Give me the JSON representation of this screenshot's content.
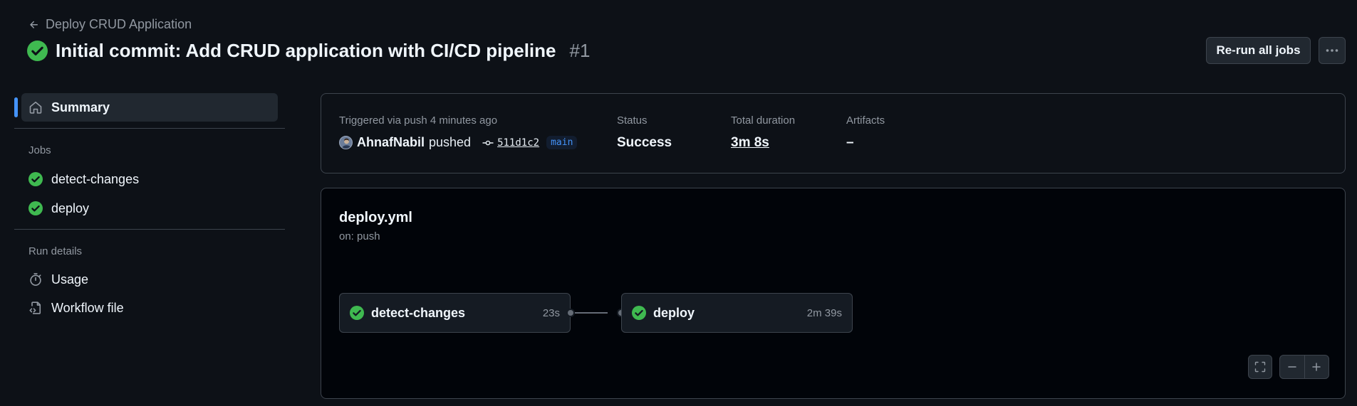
{
  "header": {
    "back_label": "Deploy CRUD Application",
    "title": "Initial commit: Add CRUD application with CI/CD pipeline",
    "run_number": "#1",
    "rerun_label": "Re-run all jobs",
    "status_icon": "check-circle-fill-icon"
  },
  "sidebar": {
    "summary_label": "Summary",
    "jobs_heading": "Jobs",
    "jobs": [
      {
        "label": "detect-changes",
        "status": "success"
      },
      {
        "label": "deploy",
        "status": "success"
      }
    ],
    "run_details_heading": "Run details",
    "run_details": [
      {
        "label": "Usage",
        "icon": "stopwatch-icon"
      },
      {
        "label": "Workflow file",
        "icon": "file-code-icon"
      }
    ]
  },
  "summary": {
    "trigger_text": "Triggered via push 4 minutes ago",
    "actor": "AhnafNabil",
    "action": "pushed",
    "commit_sha": "511d1c2",
    "branch": "main",
    "status_label": "Status",
    "status_value": "Success",
    "duration_label": "Total duration",
    "duration_value": "3m 8s",
    "artifacts_label": "Artifacts",
    "artifacts_value": "–"
  },
  "workflow": {
    "file_name": "deploy.yml",
    "trigger": "on: push",
    "jobs": [
      {
        "name": "detect-changes",
        "duration": "23s",
        "status": "success"
      },
      {
        "name": "deploy",
        "duration": "2m 39s",
        "status": "success"
      }
    ]
  },
  "colors": {
    "background": "#0d1117",
    "success": "#3fb950",
    "accent": "#4493f8",
    "border": "#3d444d"
  }
}
